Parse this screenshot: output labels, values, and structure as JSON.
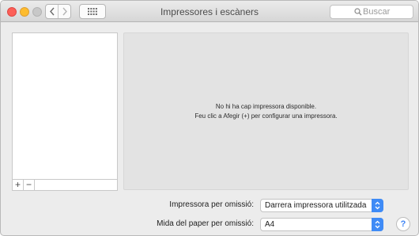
{
  "window": {
    "title": "Impressores i escàners"
  },
  "nav": {
    "back_icon": "chevron-left-icon",
    "forward_icon": "chevron-right-icon",
    "grid_icon": "grid-icon"
  },
  "search": {
    "placeholder": "Buscar",
    "value": ""
  },
  "printer_list": {
    "items": [],
    "add_label": "+",
    "remove_label": "−"
  },
  "detail": {
    "message_line1": "No hi ha cap impressora disponible.",
    "message_line2": "Feu clic a Afegir (+) per configurar una impressora."
  },
  "defaults": {
    "printer_label": "Impressora per omissió:",
    "printer_value": "Darrera impressora utilitzada",
    "paper_label": "Mida del paper per omissió:",
    "paper_value": "A4"
  },
  "help": {
    "label": "?"
  },
  "colors": {
    "close": "#fc5f57",
    "minimize": "#fdbc2e",
    "zoom": "#c8c8c8",
    "accent": "#3f8bf6"
  }
}
